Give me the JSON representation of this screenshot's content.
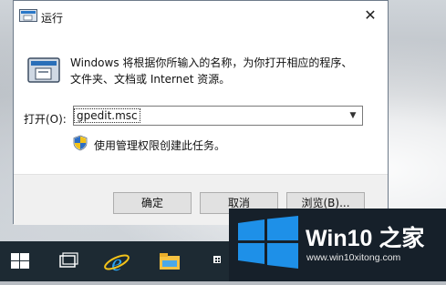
{
  "dialog": {
    "title": "运行",
    "description_line1": "Windows 将根据你所输入的名称，为你打开相应的程序、",
    "description_line2": "文件夹、文档或 Internet 资源。",
    "open_label": "打开(O):",
    "command_value": "gpedit.msc",
    "admin_note": "使用管理权限创建此任务。",
    "buttons": {
      "ok": "确定",
      "cancel": "取消",
      "browse": "浏览(B)..."
    }
  },
  "taskbar": {
    "items": [
      "start-icon",
      "task-view-icon",
      "internet-explorer-icon",
      "file-explorer-icon",
      "store-icon"
    ]
  },
  "watermark": {
    "text": "Win10 之家",
    "url": "www.win10xitong.com"
  },
  "colors": {
    "taskbar": "#1d2a33",
    "windows_blue": "#1e90e8"
  }
}
